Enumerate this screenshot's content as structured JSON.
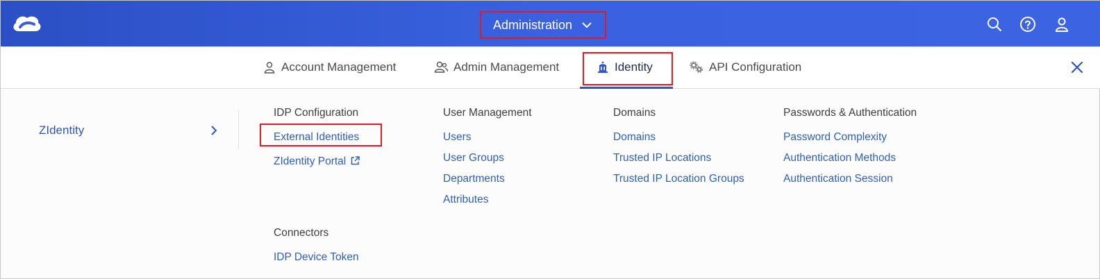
{
  "header": {
    "menu_label": "Administration",
    "icons": [
      "cloud-logo-icon",
      "search-icon",
      "help-icon",
      "user-icon"
    ],
    "brand_color": "#3a62e0",
    "highlight_color": "#e01b24"
  },
  "tabs": [
    {
      "label": "Account Management",
      "icon": "person-icon"
    },
    {
      "label": "Admin Management",
      "icon": "admin-users-icon"
    },
    {
      "label": "Identity",
      "icon": "identity-building-icon",
      "active": true
    },
    {
      "label": "API Configuration",
      "icon": "gears-icon"
    }
  ],
  "sidebar": {
    "item_label": "ZIdentity"
  },
  "sections": {
    "idp": {
      "title": "IDP Configuration",
      "links": [
        "External Identities",
        "ZIdentity Portal"
      ]
    },
    "user_management": {
      "title": "User Management",
      "links": [
        "Users",
        "User Groups",
        "Departments",
        "Attributes"
      ]
    },
    "domains": {
      "title": "Domains",
      "links": [
        "Domains",
        "Trusted IP Locations",
        "Trusted IP Location Groups"
      ]
    },
    "passwords": {
      "title": "Passwords & Authentication",
      "links": [
        "Password Complexity",
        "Authentication Methods",
        "Authentication Session"
      ]
    },
    "connectors": {
      "title": "Connectors",
      "links": [
        "IDP Device Token"
      ]
    }
  }
}
